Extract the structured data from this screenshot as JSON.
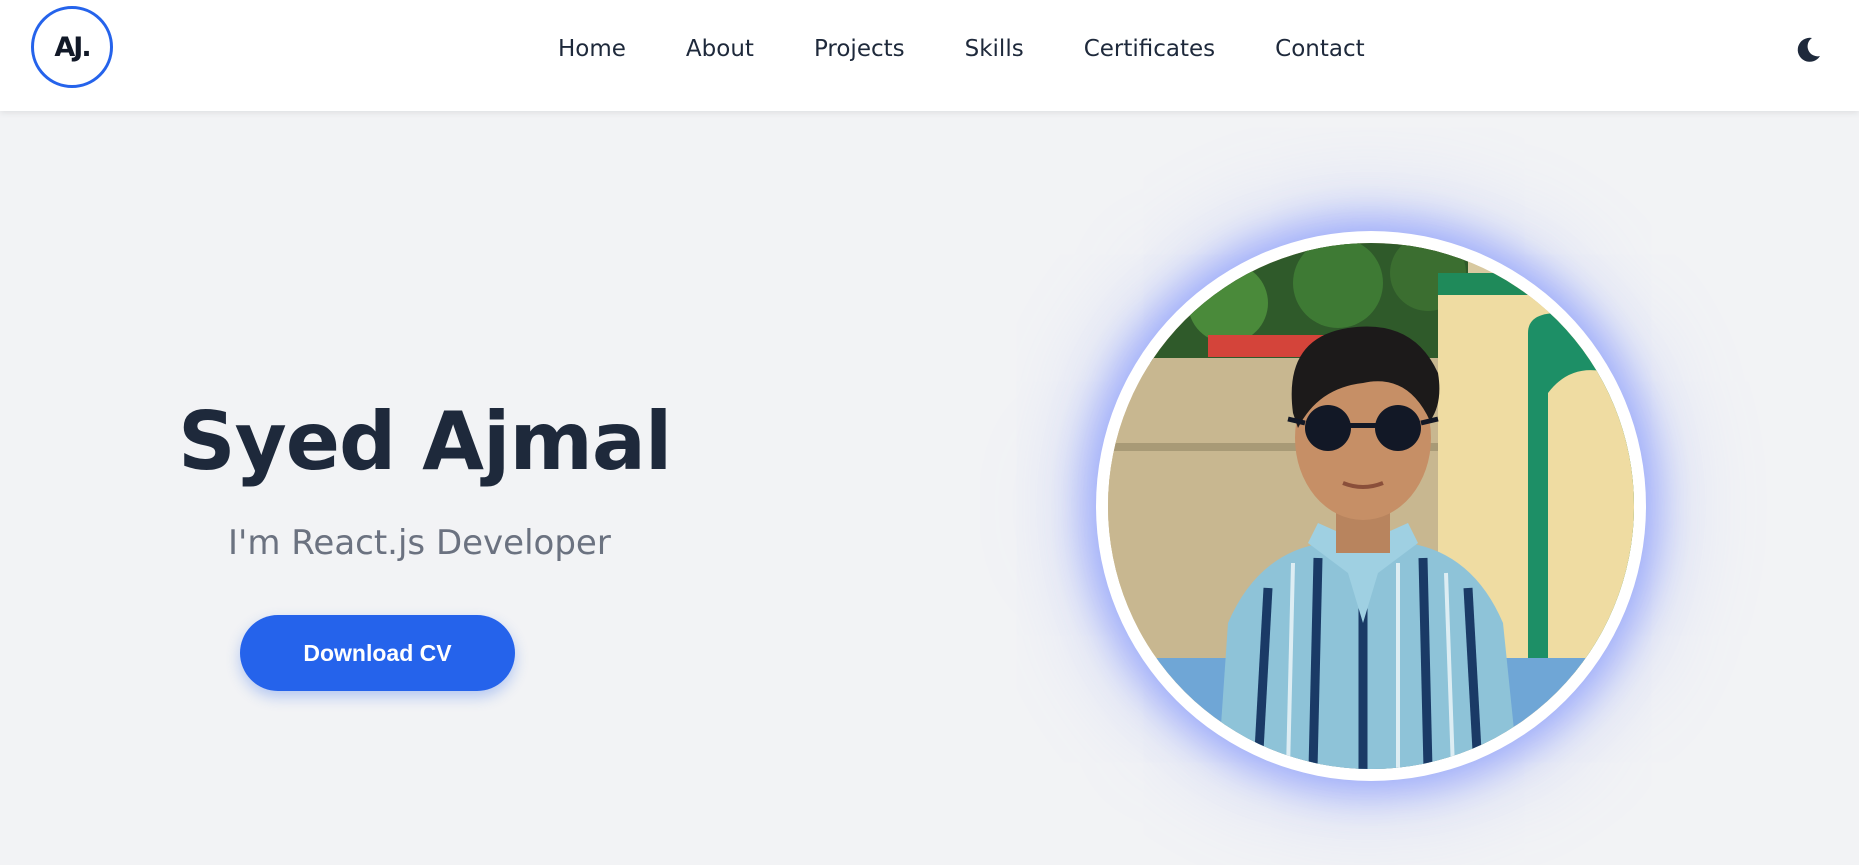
{
  "logo": {
    "text": "AJ."
  },
  "nav": {
    "items": [
      {
        "label": "Home"
      },
      {
        "label": "About"
      },
      {
        "label": "Projects"
      },
      {
        "label": "Skills"
      },
      {
        "label": "Certificates"
      },
      {
        "label": "Contact"
      }
    ]
  },
  "theme_toggle": {
    "icon": "moon-icon"
  },
  "hero": {
    "name": "Syed Ajmal",
    "role": "I'm React.js Developer",
    "cta_label": "Download CV"
  },
  "profile_photo": {
    "icon": "profile-photo"
  },
  "colors": {
    "accent": "#2563eb",
    "text": "#1e293b",
    "muted": "#6b7280",
    "background": "#f2f3f5",
    "navbar": "#ffffff"
  }
}
